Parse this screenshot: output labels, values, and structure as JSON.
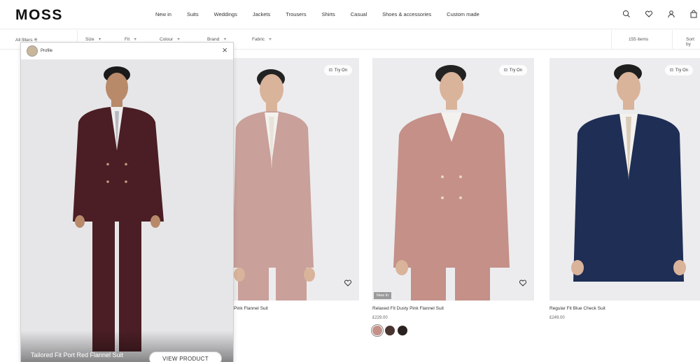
{
  "brand": "MOSS",
  "nav": [
    "New in",
    "Suits",
    "Weddings",
    "Jackets",
    "Trousers",
    "Shirts",
    "Casual",
    "Shoes & accessories",
    "Custom made"
  ],
  "icons": [
    "search-icon",
    "heart-icon",
    "account-icon",
    "bag-icon"
  ],
  "filters": {
    "all_filters": "All filters",
    "size": "Size",
    "fit": "Fit",
    "colour": "Colour",
    "brand": "Brand",
    "fabric": "Fabric",
    "items_count": "155 items",
    "sort_by": "Sort by"
  },
  "modal": {
    "profile_label": "Profile",
    "close_glyph": "×",
    "product_title": "Tailored Fit Port Red Flannel Suit",
    "view_button": "VIEW PRODUCT"
  },
  "products": [
    {
      "name": "Tailored Fit Dusty Pink Flannel Suit",
      "try_on": "Try On",
      "suit_color": "#c9a09a"
    },
    {
      "name": "Relaxed Fit Dusty Pink Flannel Suit",
      "price": "£229.00",
      "badge": "New In",
      "try_on": "Try On",
      "suit_color": "#c49088",
      "swatches": [
        "#c49088",
        "#4a3430",
        "#2a2220"
      ]
    },
    {
      "name": "Regular Fit Blue Check Suit",
      "price": "£249.00",
      "try_on": "Try On",
      "suit_color": "#1f2e55"
    }
  ],
  "modal_suit_color": "#4a1e24"
}
